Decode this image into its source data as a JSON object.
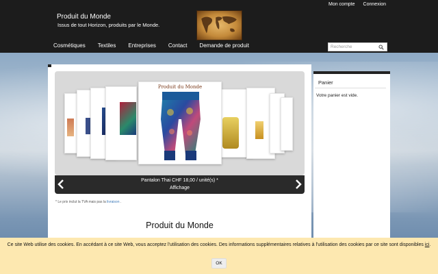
{
  "header": {
    "site_title": "Produit du Monde",
    "site_subtitle": "Issus de tout Horizon, produits par le Monde.",
    "top_links": [
      "Mon compte",
      "Connexion"
    ],
    "nav": [
      "Cosmétiques",
      "Textiles",
      "Entreprises",
      "Contact",
      "Demande de produit"
    ],
    "search_placeholder": "Recherche"
  },
  "gallery": {
    "product_card_brand": "Produit du Monde",
    "caption_line1": "Pantalon Thai CHF 18,00 / unité(s) *",
    "caption_line2": "Affichage"
  },
  "tva_note": {
    "prefix": "* Le prix inclut la TVA mais pas la",
    "link": "livraison",
    "suffix": "."
  },
  "main_heading": "Produit du Monde",
  "sidebar": {
    "title": "Panier",
    "text": "Votre panier est vide."
  },
  "cookie": {
    "text": "Ce site Web utilise des cookies. En accédant à ce site Web, vous acceptez l'utilisation des cookies. Des informations supplémentaires relatives à l'utilisation des cookies par ce site sont disponibles",
    "link": "ici",
    "end": ".",
    "ok_label": "OK"
  },
  "colors": {
    "header_bg": "#1c1c1c",
    "cookie_bg": "#fde8b0",
    "link": "#3a78b8"
  }
}
